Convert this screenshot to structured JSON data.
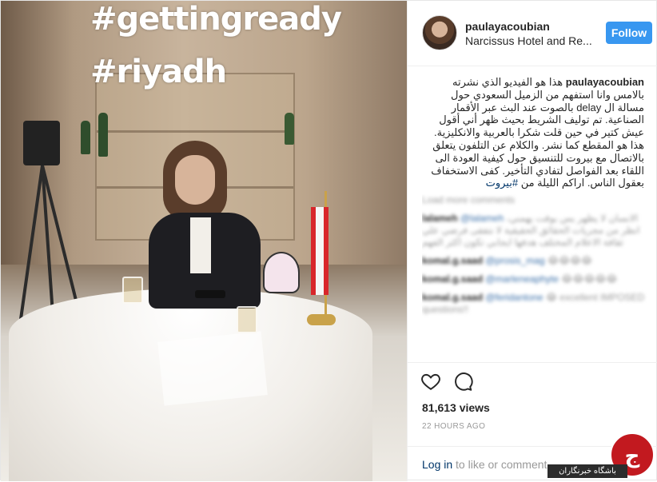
{
  "media": {
    "hashtag_1": "#gettingready",
    "hashtag_2": "#riyadh"
  },
  "header": {
    "username": "paulayacoubian",
    "location": "Narcissus Hotel and Re...",
    "follow_label": "Follow"
  },
  "caption": {
    "username": "paulayacoubian",
    "text": "هذا هو الفيديو الذي نشرته بالامس وانا استفهم من الزميل السعودي حول مسالة ال delay بالصوت عند البث عبر الأقمار الصناعية. تم توليف الشريط بحيث ظهر أني أقول عيش كتير في حين قلت شكرا بالعربية والانكليزية. هذا هو المقطع كما نشر. والكلام عن التلفون يتعلق بالاتصال مع بيروت للتنسيق حول كيفية العودة الى اللقاء بعد الفواصل لتفادي التأخير. كفى الاستخفاف بعقول الناس. اراكم الليلة من",
    "hashtag": "#بيروت"
  },
  "comments": [
    {
      "user": "",
      "text": "Load more comments"
    },
    {
      "user": "lalameh",
      "mention": "@lalameh",
      "text": "الانسان لا يظهر بس بوقت يهمني، انظر من مجريات الحقائق الحقيقية لا نتفقى فرضي علي ثقافة الاعلام المختلف هدفها ايجابي تكون اكثر الفهم"
    },
    {
      "user": "komal.g.saad",
      "mention": "@prosis_mag",
      "text": "😂😂😂😂"
    },
    {
      "user": "komal.g.saad",
      "mention": "@marleneaphyte",
      "text": "😂😂😂😂😂"
    },
    {
      "user": "komal.g.saad",
      "mention": "@feridantone",
      "text": "😂 excellent IMPOSED questions!!"
    }
  ],
  "actions": {
    "views": "81,613 views",
    "time": "22 HOURS AGO",
    "login_link": "Log in",
    "login_rest": " to like or comment."
  },
  "watermark": {
    "label": "باشگاه خبرنگاران"
  },
  "colors": {
    "accent": "#3897f0",
    "link": "#003569"
  }
}
